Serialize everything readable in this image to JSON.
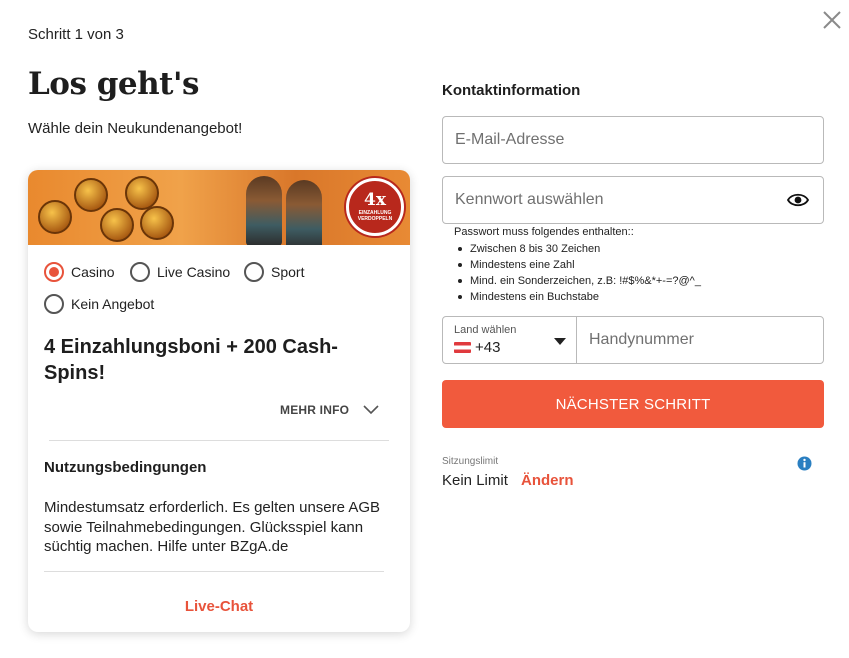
{
  "header": {
    "step": "Schritt 1 von 3",
    "title": "Los geht's",
    "subtitle": "Wähle dein Neukundenangebot!"
  },
  "offer_card": {
    "banner_badge_big": "4x",
    "banner_badge_small": "EINZAHLUNG VERDOPPELN",
    "options": [
      {
        "label": "Casino",
        "selected": true
      },
      {
        "label": "Live Casino",
        "selected": false
      },
      {
        "label": "Sport",
        "selected": false
      },
      {
        "label": "Kein Angebot",
        "selected": false
      }
    ],
    "headline": "4 Einzahlungsboni + 200 Cash-Spins!",
    "more_info": "MEHR INFO",
    "terms_title": "Nutzungsbedingungen",
    "terms_text": "Mindestumsatz erforderlich. Es gelten unsere AGB sowie Teilnahmebedingungen. Glücksspiel kann süchtig machen. Hilfe unter BZgA.de",
    "live_chat": "Live-Chat"
  },
  "contact": {
    "title": "Kontaktinformation",
    "email_placeholder": "E-Mail-Adresse",
    "password_placeholder": "Kennwort auswählen",
    "password_rules_title": "Passwort muss folgendes enthalten::",
    "password_rules": [
      "Zwischen 8 bis 30 Zeichen",
      "Mindestens eine Zahl",
      "Mind. ein Sonderzeichen, z.B: !#$%&*+-=?@^_",
      "Mindestens ein Buchstabe"
    ],
    "country_label": "Land wählen",
    "country_code": "+43",
    "phone_placeholder": "Handynummer",
    "next_button": "NÄCHSTER SCHRITT",
    "session_limit_label": "Sitzungslimit",
    "session_limit_value": "Kein Limit",
    "session_limit_change": "Ändern"
  },
  "colors": {
    "accent": "#f15a3d",
    "accent_text": "#e8533b",
    "info": "#2a7fc1"
  },
  "icons": [
    "close-icon",
    "eye-icon",
    "chevron-down-icon",
    "caret-down-icon",
    "info-icon",
    "austria-flag-icon"
  ]
}
